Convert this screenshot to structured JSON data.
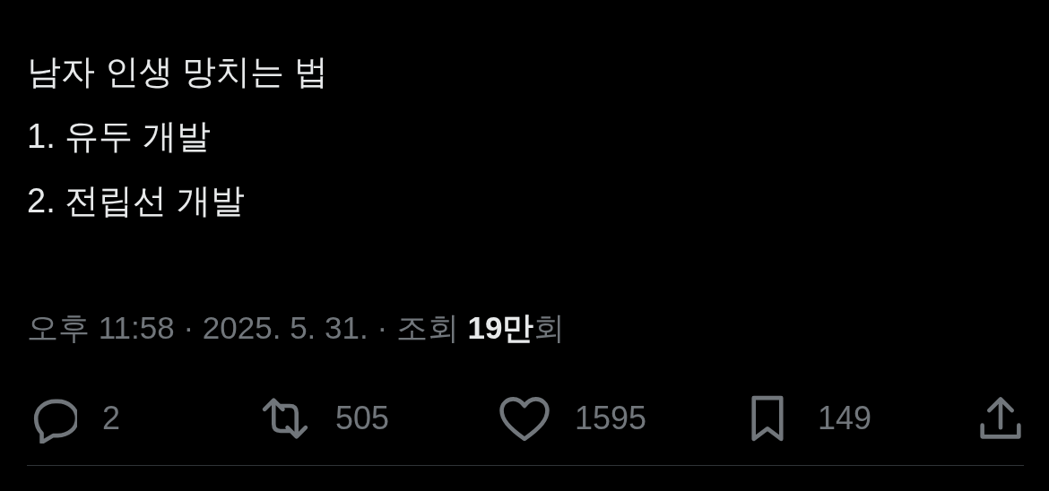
{
  "tweet": {
    "lines": [
      "남자 인생 망치는 법",
      "1. 유두 개발",
      "2. 전립선 개발"
    ],
    "meta": "오후 11:58 · 2025. 5. 31. · 조회 **19만**회",
    "actions": [
      {
        "kind": "reply",
        "count": "2"
      },
      {
        "kind": "retweet",
        "count": "505"
      },
      {
        "kind": "like",
        "count": "1595"
      },
      {
        "kind": "bookmark",
        "count": "149"
      },
      {
        "kind": "share"
      }
    ]
  }
}
